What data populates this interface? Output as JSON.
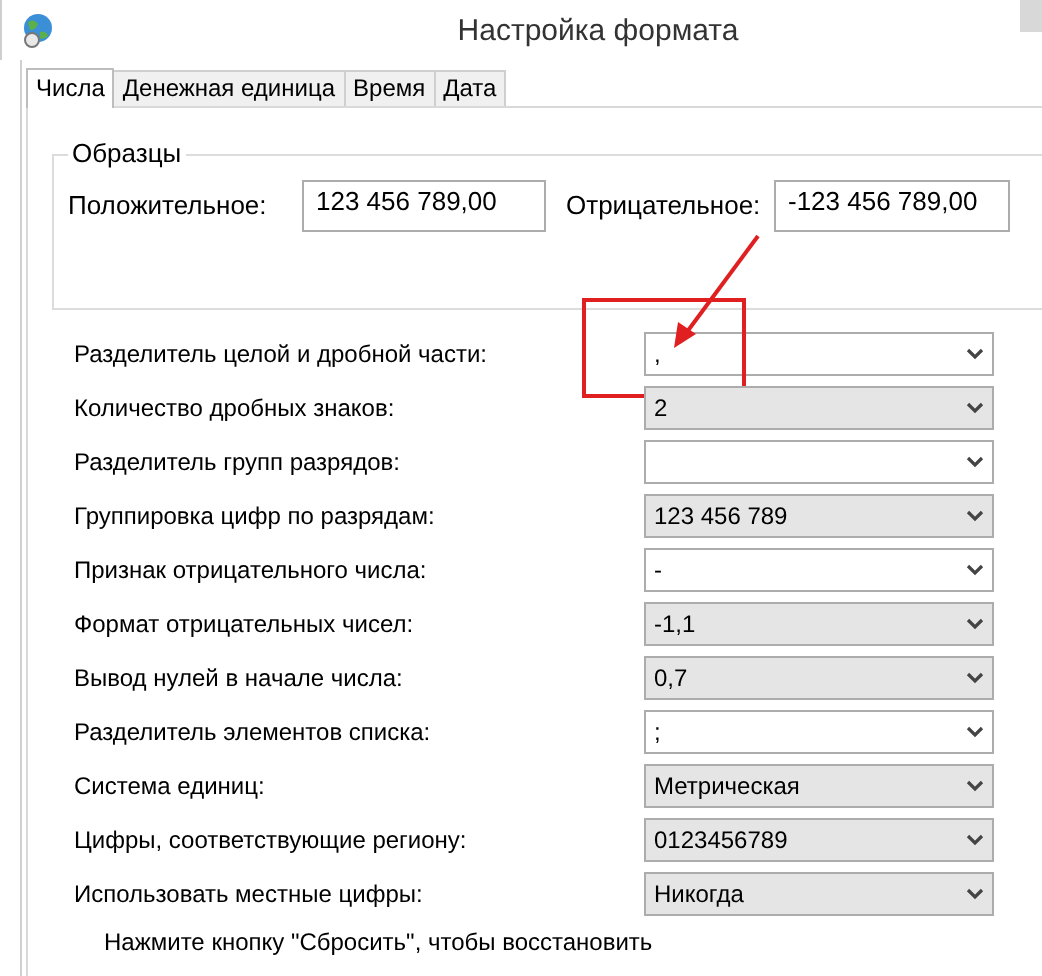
{
  "window": {
    "title": "Настройка формата"
  },
  "tabs": [
    {
      "label": "Числа",
      "selected": true
    },
    {
      "label": "Денежная единица",
      "selected": false
    },
    {
      "label": "Время",
      "selected": false
    },
    {
      "label": "Дата",
      "selected": false
    }
  ],
  "samples": {
    "title": "Образцы",
    "items": [
      {
        "label": "Положительное:",
        "value": "123 456 789,00"
      },
      {
        "label": "Отрицательное:",
        "value": "-123 456 789,00"
      }
    ]
  },
  "settings": [
    {
      "label": "Разделитель целой и дробной части:",
      "kind": "editable",
      "value": ",",
      "highlighted": true
    },
    {
      "label": "Количество дробных знаков:",
      "kind": "list",
      "value": "2",
      "highlighted": false
    },
    {
      "label": "Разделитель групп разрядов:",
      "kind": "editable",
      "highlighted": false
    },
    {
      "label": "Группировка цифр по разрядам:",
      "kind": "list",
      "value": "123 456 789",
      "highlighted": false
    },
    {
      "label": "Признак отрицательного числа:",
      "kind": "editable",
      "value": "-",
      "highlighted": false
    },
    {
      "label": "Формат отрицательных чисел:",
      "kind": "list",
      "value": "-1,1",
      "highlighted": false
    },
    {
      "label": "Вывод нулей в начале числа:",
      "kind": "list",
      "value": "0,7",
      "highlighted": false
    },
    {
      "label": "Разделитель элементов списка:",
      "kind": "editable",
      "value": ";",
      "highlighted": false
    },
    {
      "label": "Система единиц:",
      "kind": "list",
      "value": "Метрическая",
      "highlighted": false
    },
    {
      "label": "Цифры, соответствующие региону:",
      "kind": "list",
      "value": "0123456789",
      "highlighted": false
    },
    {
      "label": "Использовать местные цифры:",
      "kind": "list",
      "value": "Никогда",
      "highlighted": false
    }
  ],
  "note": "Нажмите кнопку \"Сбросить\", чтобы восстановить"
}
